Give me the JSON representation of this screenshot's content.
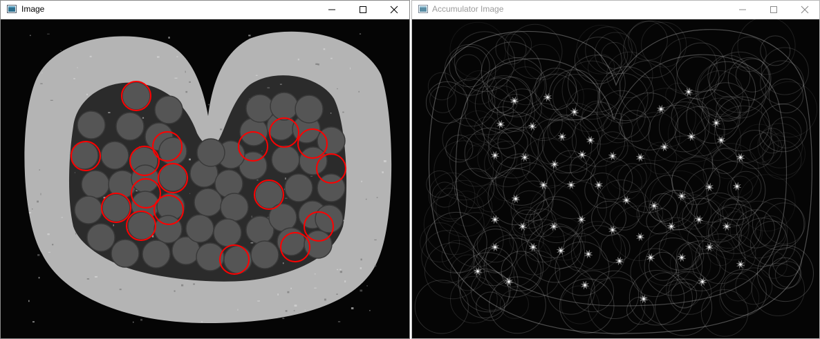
{
  "windows": [
    {
      "title": "Image",
      "active": true,
      "controls": [
        "minimize-icon",
        "maximize-icon",
        "close-icon"
      ],
      "content": "grayscale cross-section scan of bundled cylindrical rods inside a heart-shaped housing, with red circles marking detected circles",
      "overlay_color": "#ff0000"
    },
    {
      "title": "Accumulator Image",
      "active": false,
      "controls": [
        "minimize-icon",
        "maximize-icon",
        "close-icon"
      ],
      "content": "Hough transform accumulator image with many faint overlapping white circles and bright star-shaped peaks"
    }
  ],
  "colors": {
    "titlebar_bg": "#ffffff",
    "active_title": "#000000",
    "inactive_title": "#9a9a9a",
    "canvas_bg": "#050505",
    "housing": "#b4b4b4",
    "rod": "#555555",
    "detected_circle": "#ff0000",
    "accumulator_stroke": "#d8d8d8"
  }
}
